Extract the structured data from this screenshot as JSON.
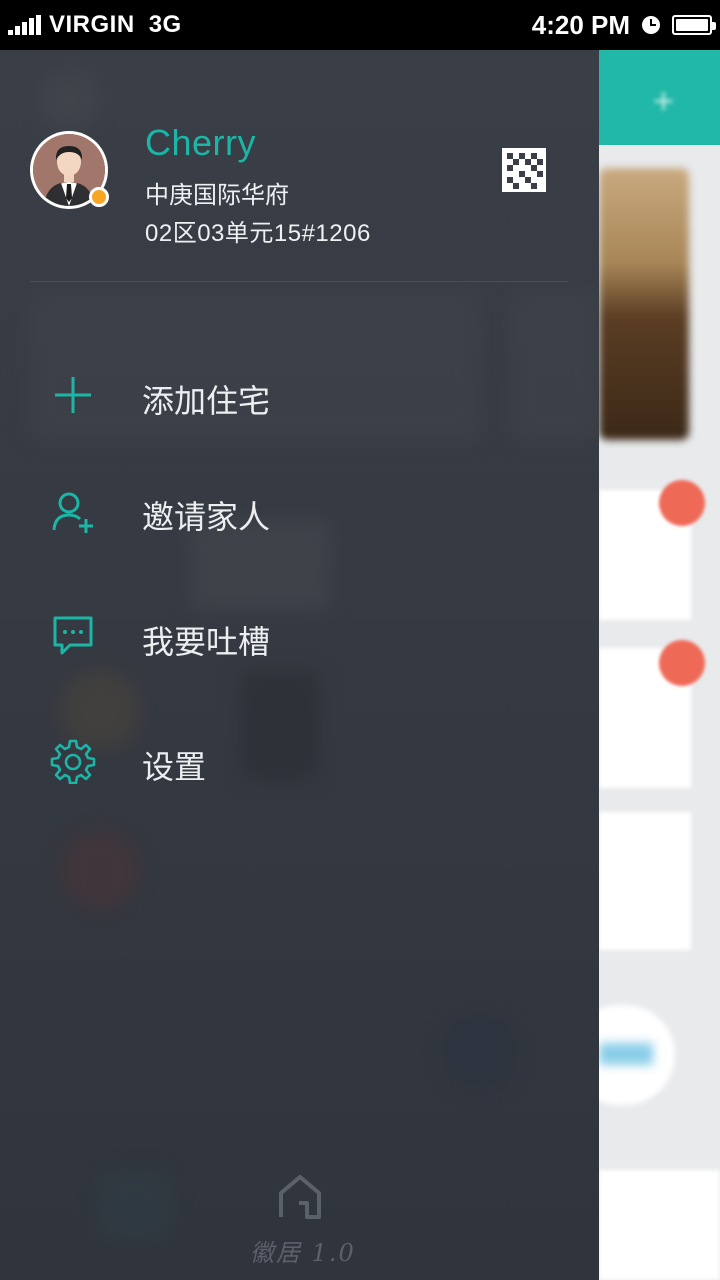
{
  "status_bar": {
    "carrier": "VIRGIN",
    "network": "3G",
    "time": "4:20 PM"
  },
  "profile": {
    "name": "Cherry",
    "address_line1": "中庚国际华府",
    "address_line2": "02区03单元15#1206",
    "online_dot_color": "#f6a623",
    "qr_icon": "qr-code-icon"
  },
  "menu": [
    {
      "icon": "plus-icon",
      "label": "添加住宅"
    },
    {
      "icon": "add-user-icon",
      "label": "邀请家人"
    },
    {
      "icon": "chat-bubble-icon",
      "label": "我要吐槽"
    },
    {
      "icon": "gear-icon",
      "label": "设置"
    }
  ],
  "footer": {
    "brand": "徽居 1.0",
    "logo_icon": "house-logo-icon"
  },
  "colors": {
    "accent": "#1bb6a6",
    "drawer_bg": "#353941",
    "header_teal": "#22b8a8",
    "badge_red": "#ee6a57"
  }
}
